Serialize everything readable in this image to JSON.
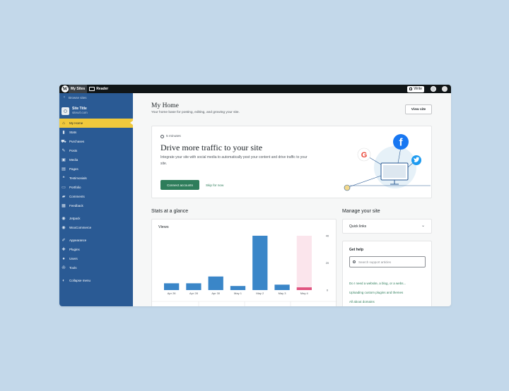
{
  "topbar": {
    "my_sites": "My Sites",
    "reader": "Reader",
    "write": "Write"
  },
  "sidebar": {
    "browse": "Browse sites",
    "site_title": "Site Title",
    "site_url": "siteurl.com",
    "items": [
      {
        "label": "My Home",
        "icon": "home-icon"
      },
      {
        "label": "Stats",
        "icon": "stats-icon"
      },
      {
        "label": "Purchases",
        "icon": "cart-icon"
      },
      {
        "label": "Posts",
        "icon": "pin-icon"
      },
      {
        "label": "Media",
        "icon": "media-icon"
      },
      {
        "label": "Pages",
        "icon": "page-icon"
      },
      {
        "label": "Testimonials",
        "icon": "quote-icon"
      },
      {
        "label": "Portfolio",
        "icon": "folder-icon"
      },
      {
        "label": "Comments",
        "icon": "comment-icon"
      },
      {
        "label": "Feedback",
        "icon": "feedback-icon"
      },
      {
        "label": "Jetpack",
        "icon": "jetpack-icon"
      },
      {
        "label": "WooCommerce",
        "icon": "woo-icon"
      },
      {
        "label": "Appearance",
        "icon": "brush-icon"
      },
      {
        "label": "Plugins",
        "icon": "plug-icon"
      },
      {
        "label": "Users",
        "icon": "users-icon"
      },
      {
        "label": "Tools",
        "icon": "wrench-icon"
      }
    ],
    "collapse": "Collapse menu"
  },
  "main": {
    "title": "My Home",
    "subtitle": "Your home base for posting, editing, and growing your site.",
    "view_site": "View site"
  },
  "traffic_card": {
    "time": "5 minutes",
    "title": "Drive more traffic to your site",
    "body": "Integrate your site with social media to automatically post your content and drive traffic to your site.",
    "connect": "Connect accounts",
    "skip": "Skip for now"
  },
  "stats": {
    "heading": "Stats at a glance",
    "views_label": "Views"
  },
  "chart_data": {
    "type": "bar",
    "categories": [
      "Apr 26",
      "Apr 28",
      "Apr 30",
      "May 1",
      "May 2",
      "May 3",
      "May 4"
    ],
    "values": [
      5,
      5,
      10,
      3,
      40,
      4,
      2
    ],
    "highlighted_index": 6,
    "ylim": [
      0,
      40
    ],
    "yticks": [
      "40",
      "20",
      "0"
    ],
    "bar_color": "#3a86c8",
    "highlight_color": "#e0537f",
    "highlight_bg": "#fbe5ec",
    "grid": false
  },
  "manage": {
    "heading": "Manage your site",
    "quick_links": "Quick links",
    "get_help": "Get help",
    "search_placeholder": "Search support articles",
    "help_links": [
      "Do I need a website, a blog, or a webs...",
      "Uploading custom plugins and themes",
      "All about domains"
    ]
  },
  "colors": {
    "sidebar": "#2a5a94",
    "accent_yellow": "#f0c93c",
    "primary_green": "#2e7d5b",
    "background": "#c3d8ea"
  }
}
